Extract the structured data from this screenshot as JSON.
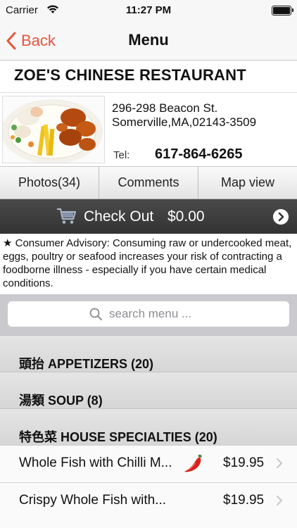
{
  "status_bar": {
    "carrier": "Carrier",
    "time": "11:27 PM"
  },
  "nav": {
    "back_label": "Back",
    "title": "Menu"
  },
  "restaurant": {
    "name": "ZOE'S CHINESE RESTAURANT",
    "address_line1": "296-298 Beacon St.",
    "address_line2": "Somerville,MA,02143-3509",
    "tel_label": "Tel:",
    "tel_number": "617-864-6265"
  },
  "tabs": [
    {
      "label": "Photos(34)"
    },
    {
      "label": "Comments"
    },
    {
      "label": "Map view"
    }
  ],
  "checkout": {
    "label": "Check Out",
    "total": "$0.00"
  },
  "advisory": "★ Consumer Advisory: Consuming raw or undercooked meat, eggs, poultry or seafood increases your risk of contracting a foodborne illness - especially if you have certain medical conditions.",
  "search": {
    "placeholder": "search menu ..."
  },
  "sections": [
    {
      "label": "頭抬 APPETIZERS (20)"
    },
    {
      "label": "湯類 SOUP (8)"
    },
    {
      "label": "特色菜 HOUSE SPECIALTIES (20)"
    }
  ],
  "items": [
    {
      "name": "Whole Fish with Chilli M...",
      "price": "$19.95",
      "spicy_icon": "chili-pepper-icon"
    },
    {
      "name": "Crispy Whole Fish with...",
      "price": "$19.95"
    }
  ],
  "colors": {
    "accent": "#e8543a",
    "checkout_bg": "#3d3d3d",
    "section_bg": "#dcdcdc",
    "search_bg": "#c9c9ce"
  }
}
